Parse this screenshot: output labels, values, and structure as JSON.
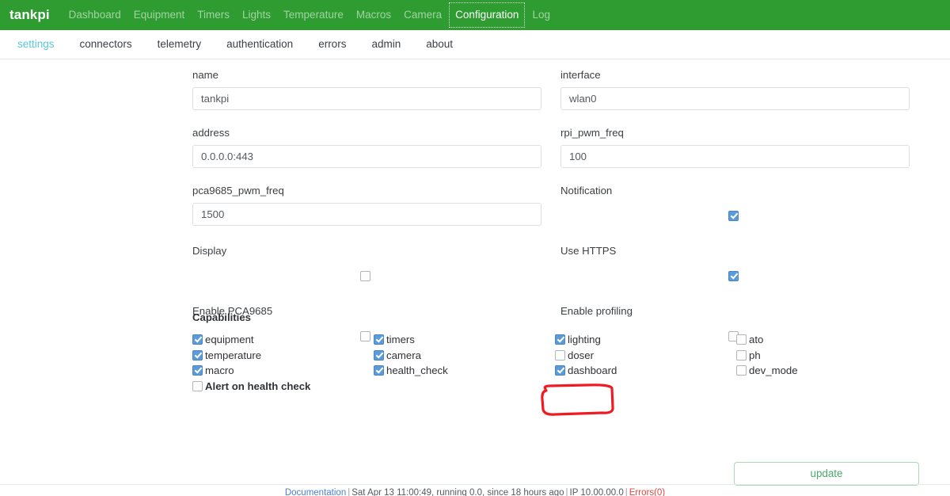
{
  "navbar": {
    "brand": "tankpi",
    "links": [
      {
        "label": "Dashboard",
        "active": false
      },
      {
        "label": "Equipment",
        "active": false
      },
      {
        "label": "Timers",
        "active": false
      },
      {
        "label": "Lights",
        "active": false
      },
      {
        "label": "Temperature",
        "active": false
      },
      {
        "label": "Macros",
        "active": false
      },
      {
        "label": "Camera",
        "active": false
      },
      {
        "label": "Configuration",
        "active": true
      },
      {
        "label": "Log",
        "active": false
      }
    ]
  },
  "subnav": {
    "items": [
      {
        "label": "settings",
        "active": true
      },
      {
        "label": "connectors",
        "active": false
      },
      {
        "label": "telemetry",
        "active": false
      },
      {
        "label": "authentication",
        "active": false
      },
      {
        "label": "errors",
        "active": false
      },
      {
        "label": "admin",
        "active": false
      },
      {
        "label": "about",
        "active": false
      }
    ]
  },
  "form": {
    "name": {
      "label": "name",
      "value": "tankpi"
    },
    "interface": {
      "label": "interface",
      "value": "wlan0"
    },
    "address": {
      "label": "address",
      "value": "0.0.0.0:443"
    },
    "rpi_pwm_freq": {
      "label": "rpi_pwm_freq",
      "value": "100"
    },
    "pca9685_pwm_freq": {
      "label": "pca9685_pwm_freq",
      "value": "1500"
    },
    "notification": {
      "label": "Notification",
      "checked": true
    },
    "display": {
      "label": "Display",
      "checked": false
    },
    "use_https": {
      "label": "Use HTTPS",
      "checked": true
    },
    "enable_pca9685": {
      "label": "Enable PCA9685",
      "checked": false
    },
    "enable_profiling": {
      "label": "Enable profiling",
      "checked": false
    }
  },
  "capabilities": {
    "title": "Capabilities",
    "columns": [
      [
        {
          "label": "equipment",
          "checked": true,
          "bold": false
        },
        {
          "label": "temperature",
          "checked": true,
          "bold": false
        },
        {
          "label": "macro",
          "checked": true,
          "bold": false
        },
        {
          "label": "Alert on health check",
          "checked": false,
          "bold": true
        }
      ],
      [
        {
          "label": "timers",
          "checked": true,
          "bold": false
        },
        {
          "label": "camera",
          "checked": true,
          "bold": false
        },
        {
          "label": "health_check",
          "checked": true,
          "bold": false
        }
      ],
      [
        {
          "label": "lighting",
          "checked": true,
          "bold": false
        },
        {
          "label": "doser",
          "checked": false,
          "bold": false
        },
        {
          "label": "dashboard",
          "checked": true,
          "bold": false
        }
      ],
      [
        {
          "label": "ato",
          "checked": false,
          "bold": false
        },
        {
          "label": "ph",
          "checked": false,
          "bold": false
        },
        {
          "label": "dev_mode",
          "checked": false,
          "bold": false
        }
      ]
    ]
  },
  "actions": {
    "update_label": "update"
  },
  "footer": {
    "documentation": "Documentation",
    "status": "Sat Apr 13 11:00:49, running 0.0, since 18 hours ago",
    "ip": "IP 10.00.00.0",
    "errors": "Errors(0)",
    "separator": "|"
  },
  "colors": {
    "brand_green": "#2e9c31",
    "accent_teal": "#5bc8d8",
    "checkbox_blue": "#5c9bd8",
    "update_green": "#4aa96c",
    "annotation_red": "#ee1c22",
    "error_red": "#e2443b"
  }
}
